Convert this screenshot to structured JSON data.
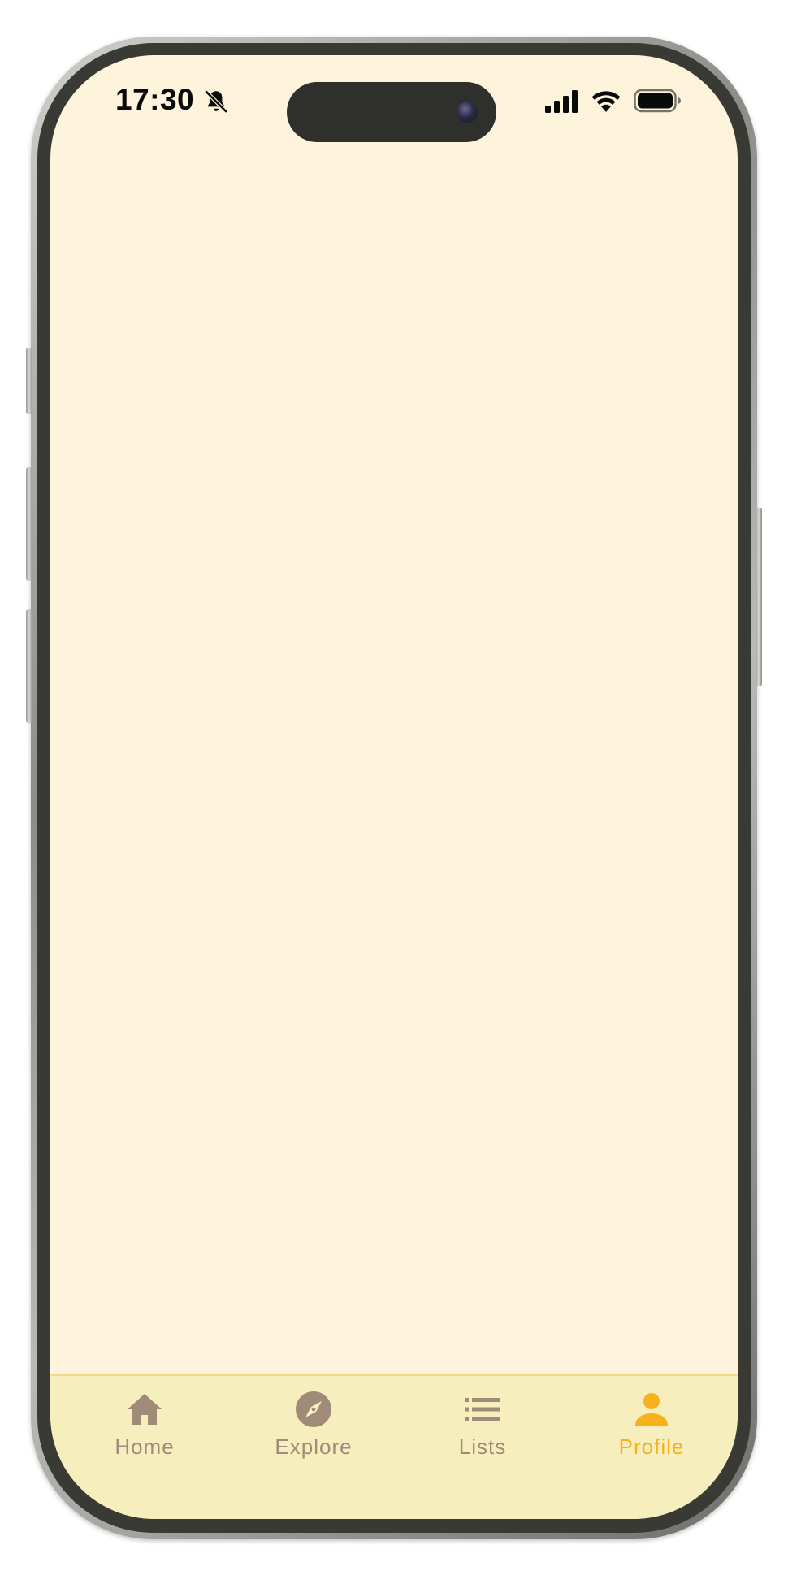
{
  "status_bar": {
    "time": "17:30"
  },
  "tab_bar": {
    "items": [
      {
        "label": "Home",
        "icon": "home-icon",
        "active": false
      },
      {
        "label": "Explore",
        "icon": "compass-icon",
        "active": false
      },
      {
        "label": "Lists",
        "icon": "list-icon",
        "active": false
      },
      {
        "label": "Profile",
        "icon": "person-icon",
        "active": true
      }
    ]
  },
  "colors": {
    "screen_background": "#fef4dc",
    "tab_bar_background": "#f6eebc",
    "tab_inactive": "#a08a78",
    "tab_active": "#f6b11c"
  }
}
